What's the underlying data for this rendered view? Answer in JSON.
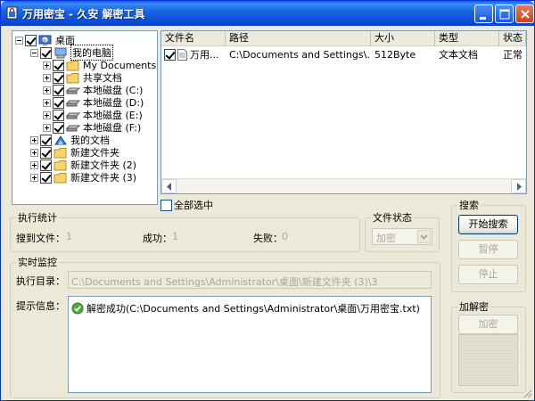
{
  "window": {
    "title": "万用密宝 - 久安  解密工具",
    "controls": [
      "minimize-icon",
      "maximize-icon",
      "close-icon"
    ],
    "accent_color": "#0a5fe8"
  },
  "tree": {
    "items": [
      {
        "label": "桌面",
        "icon": "desktop-icon",
        "checked": true,
        "expanded": true
      },
      {
        "label": "我的电脑",
        "icon": "computer-icon",
        "checked": true,
        "expanded": true,
        "selected": true
      },
      {
        "label": "My Documents",
        "icon": "folder-icon",
        "checked": true
      },
      {
        "label": "共享文档",
        "icon": "folder-icon",
        "checked": true
      },
      {
        "label": "本地磁盘 (C:)",
        "icon": "drive-icon",
        "checked": true
      },
      {
        "label": "本地磁盘 (D:)",
        "icon": "drive-icon",
        "checked": true
      },
      {
        "label": "本地磁盘 (E:)",
        "icon": "drive-icon",
        "checked": true
      },
      {
        "label": "本地磁盘 (F:)",
        "icon": "drive-icon",
        "checked": true
      },
      {
        "label": "我的文档",
        "icon": "my-documents-icon",
        "checked": true
      },
      {
        "label": "新建文件夹",
        "icon": "folder-icon",
        "checked": true
      },
      {
        "label": "新建文件夹 (2)",
        "icon": "folder-icon",
        "checked": true
      },
      {
        "label": "新建文件夹 (3)",
        "icon": "folder-icon",
        "checked": true
      }
    ]
  },
  "file_list": {
    "columns": [
      "文件名",
      "路径",
      "大小",
      "类型",
      "状态"
    ],
    "rows": [
      {
        "checked": true,
        "name": "万用...",
        "path": "C:\\Documents and Settings\\...",
        "size": "512Byte",
        "type": "文本文档",
        "status": "正常"
      }
    ]
  },
  "select_all": {
    "label": "全部选中",
    "checked": false
  },
  "stats": {
    "group_label": "执行统计",
    "found_label": "搜到文件：",
    "found_value": "1",
    "success_label": "成功：",
    "success_value": "1",
    "fail_label": "失败：",
    "fail_value": "0"
  },
  "file_status": {
    "group_label": "文件状态",
    "selected": "加密"
  },
  "search": {
    "group_label": "搜索",
    "start_label": "开始搜索",
    "pause_label": "暂停",
    "stop_label": "停止"
  },
  "monitor": {
    "group_label": "实时监控",
    "dir_label": "执行目录：",
    "dir_value": "C:\\Documents and Settings\\Administrator\\桌面\\新建文件夹 (3)\\3",
    "info_label": "提示信息：",
    "info_message": "解密成功(C:\\Documents and Settings\\Administrator\\桌面\\万用密宝.txt)"
  },
  "crypto": {
    "group_label": "加解密",
    "encrypt_label": "加密"
  }
}
